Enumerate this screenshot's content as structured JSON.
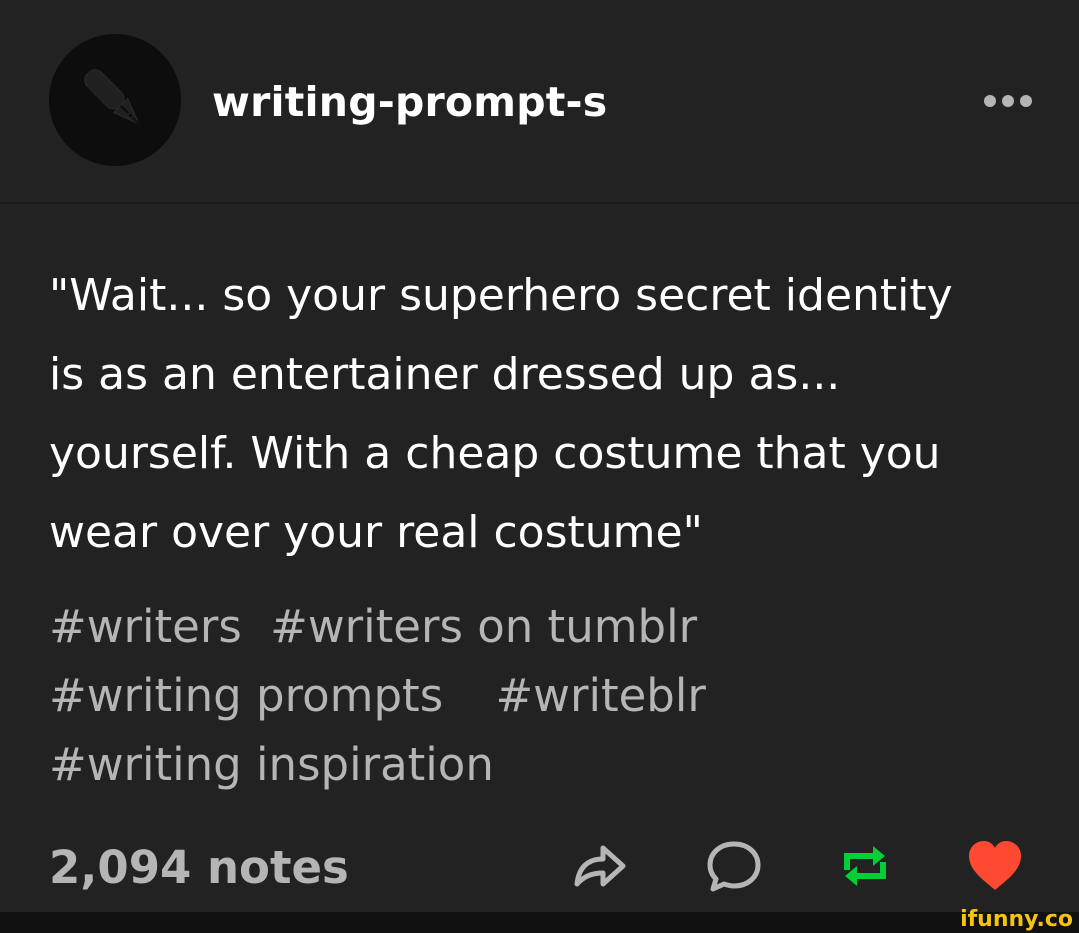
{
  "post": {
    "blog_name": "writing-prompt-s",
    "body_lines": [
      "\"Wait... so your superhero secret identity",
      "is as an entertainer dressed up as...",
      "yourself. With a cheap costume that you",
      "wear over your real costume\""
    ],
    "tag_lines": [
      [
        "#writers",
        "#writers on tumblr"
      ],
      [
        "#writing prompts",
        "#writeblr"
      ],
      [
        "#writing inspiration"
      ]
    ],
    "notes_label": "2,094 notes"
  },
  "icons": {
    "avatar": "pen-icon",
    "more": "more-dots-icon",
    "share": "share-icon",
    "reply": "reply-icon",
    "reblog": "reblog-icon",
    "like": "heart-icon"
  },
  "colors": {
    "background": "#222222",
    "text": "#ffffff",
    "tags": "#b5b5b5",
    "reblog": "#00cf35",
    "like": "#ff4930",
    "watermark": "#f4c315"
  },
  "watermark": "ifunny.co"
}
